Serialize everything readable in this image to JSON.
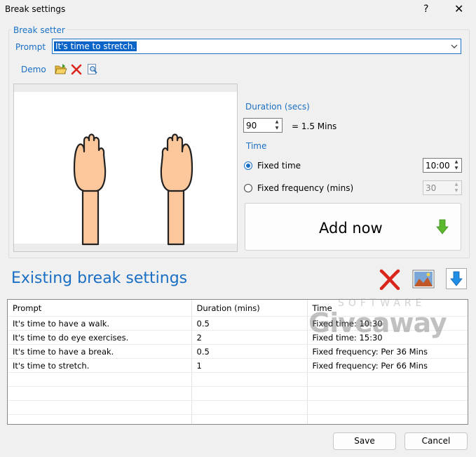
{
  "window": {
    "title": "Break settings",
    "help_glyph": "?",
    "close_glyph": "✕"
  },
  "break_setter": {
    "legend": "Break setter",
    "prompt_label": "Prompt",
    "prompt_value": "It's time to stretch.",
    "demo_label": "Demo",
    "duration_label": "Duration (secs)",
    "duration_value": "90",
    "duration_mins_text": "= 1.5 Mins",
    "time_label": "Time",
    "fixed_time_label": "Fixed time",
    "fixed_time_value": "10:00",
    "fixed_time_selected": true,
    "fixed_frequency_label": "Fixed frequency (mins)",
    "fixed_frequency_value": "30",
    "add_now_label": "Add now"
  },
  "existing": {
    "title": "Existing break settings",
    "columns": [
      "Prompt",
      "Duration (mins)",
      "Time"
    ],
    "rows": [
      [
        "It's time to have a walk.",
        "0.5",
        "Fixed time: 10:30"
      ],
      [
        "It's time to do eye exercises.",
        "2",
        "Fixed time: 15:30"
      ],
      [
        "It's time to have a break.",
        "0.5",
        "Fixed frequency: Per 36 Mins"
      ],
      [
        "It's time to stretch.",
        "1",
        "Fixed frequency: Per 66 Mins"
      ],
      [
        "",
        "",
        ""
      ],
      [
        "",
        "",
        ""
      ],
      [
        "",
        "",
        ""
      ],
      [
        "",
        "",
        ""
      ]
    ]
  },
  "watermark": {
    "top": "SOFTWARE",
    "main": "Giveaway"
  },
  "footer": {
    "save_label": "Save",
    "cancel_label": "Cancel"
  },
  "colors": {
    "accent": "#1a6fc4",
    "selection": "#0a64c8",
    "green_arrow": "#5cb82e",
    "red_x": "#d9261c"
  }
}
